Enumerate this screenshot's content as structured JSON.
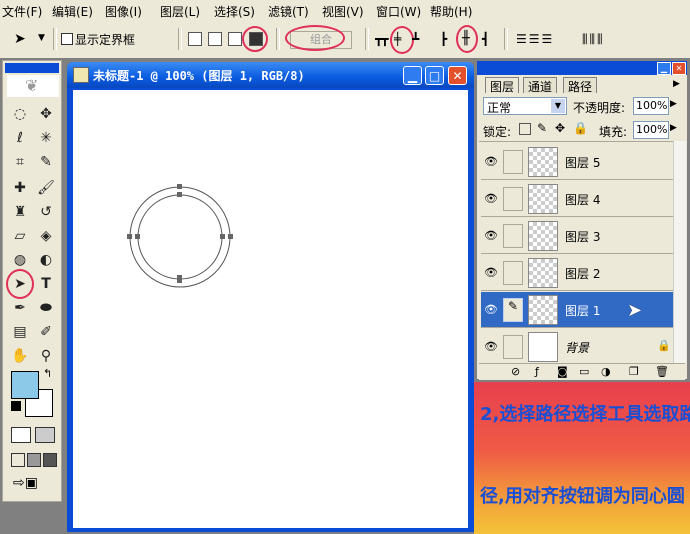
{
  "menu": [
    "文件(F)",
    "编辑(E)",
    "图像(I)",
    "图层(L)",
    "选择(S)",
    "滤镜(T)",
    "视图(V)",
    "窗口(W)",
    "帮助(H)"
  ],
  "options_bar": {
    "show_bbox_label": "显示定界框",
    "combine_label": "组合"
  },
  "document": {
    "title": "未标题-1 @ 100% (图层 1, RGB/8)"
  },
  "layers_panel": {
    "tabs": [
      "图层",
      "通道",
      "路径"
    ],
    "blend_mode": "正常",
    "opacity_label": "不透明度:",
    "opacity_value": "100%",
    "lock_label": "锁定:",
    "fill_label": "填充:",
    "fill_value": "100%",
    "layers": [
      {
        "name": "图层 5",
        "selected": false
      },
      {
        "name": "图层 4",
        "selected": false
      },
      {
        "name": "图层 3",
        "selected": false
      },
      {
        "name": "图层 2",
        "selected": false
      },
      {
        "name": "图层 1",
        "selected": true
      },
      {
        "name": "背景",
        "selected": false
      }
    ]
  },
  "annotation": {
    "line1": "2,选择路径选择工具选取路",
    "line2": "径,用对齐按钮调为同心圆"
  },
  "colors": {
    "accent_red": "#e0305a",
    "selection_blue": "#316ac5",
    "foreground": "#8cc8e8",
    "background": "#ffffff"
  }
}
